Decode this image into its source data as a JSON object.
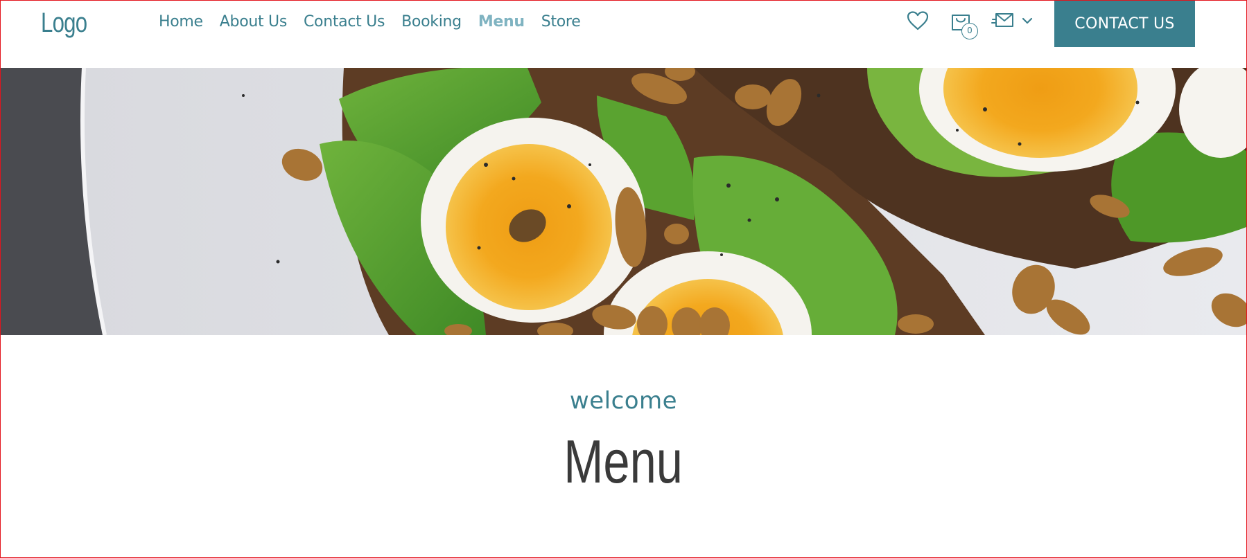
{
  "header": {
    "logo": "Logo",
    "nav": [
      {
        "label": "Home",
        "active": false
      },
      {
        "label": "About Us",
        "active": false
      },
      {
        "label": "Contact Us",
        "active": false
      },
      {
        "label": "Booking",
        "active": false
      },
      {
        "label": "Menu",
        "active": true
      },
      {
        "label": "Store",
        "active": false
      }
    ],
    "icons": {
      "wishlist": "heart-icon",
      "cart": "shopping-bag-icon",
      "messages": "envelope-icon",
      "dropdown": "chevron-down-icon"
    },
    "cart_count": "0",
    "cta_label": "CONTACT US"
  },
  "hero": {
    "image": "avocado-toast-with-soft-boiled-eggs"
  },
  "section": {
    "kicker": "welcome",
    "title": "Menu"
  },
  "colors": {
    "accent": "#3a7f8e",
    "nav_active": "#7fb3c1",
    "heading": "#3a3a3a",
    "border": "#e3141c"
  }
}
